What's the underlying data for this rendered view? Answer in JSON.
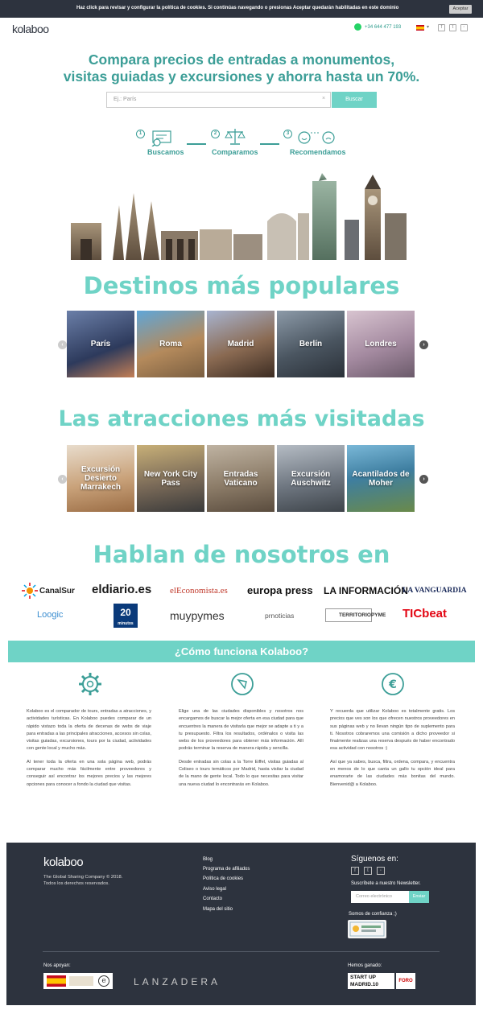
{
  "cookie": {
    "text": "Haz click para revisar y configurar la política de cookies. Si continúas navegando o presionas Aceptar quedarán habilitadas en este dominio",
    "accept": "Aceptar"
  },
  "header": {
    "logo": "kolaboo",
    "phone": "+34 644 477 193"
  },
  "hero": {
    "title_line1": "Compara precios de entradas a monumentos,",
    "title_line2": "visitas guiadas y excursiones y ahorra hasta un 70%.",
    "search_placeholder": "Ej.: París",
    "search_button": "Buscar"
  },
  "steps": [
    {
      "num": "1",
      "label": "Buscamos"
    },
    {
      "num": "2",
      "label": "Comparamos"
    },
    {
      "num": "3",
      "label": "Recomendamos"
    }
  ],
  "destinations": {
    "title": "Destinos más populares",
    "items": [
      "París",
      "Roma",
      "Madrid",
      "Berlín",
      "Londres"
    ]
  },
  "attractions": {
    "title": "Las atracciones más visitadas",
    "items": [
      "Excursión Desierto Marrakech",
      "New York City Pass",
      "Entradas Vaticano",
      "Excursión Auschwitz",
      "Acantilados de Moher"
    ]
  },
  "press": {
    "title": "Hablan de nosotros en",
    "logos": [
      "CanalSur",
      "eldiario.es",
      "elEconomista.es",
      "europa press",
      "LA INFORMACIÓN",
      "LA VANGUARDIA",
      "Loogic",
      "20 minutos",
      "muypymes",
      "prnoticias",
      "TERRITORIOPYME",
      "TICbeat"
    ]
  },
  "how": {
    "title": "¿Cómo funciona Kolaboo?",
    "col1": [
      "Kolaboo es el comparador de tours, entradas a atracciones, y actividades turísticas. En Kolaboo puedes comparar de un rápido vistazo toda la oferta de decenas de webs de viaje para entradas a las principales atracciones, accesos sin colas, visitas guiadas, excursiones, tours por la ciudad, actividades con gente local y mucho más.",
      "Al tener toda la oferta en una sola página web, podrás comparar mucho más fácilmente entre proveedores y conseguir así encontrar los mejores precios y las mejores opciones para conocer a fondo la ciudad que visitas."
    ],
    "col2": [
      "Elige una de las ciudades disponibles y nosotros nos encargamos de buscar la mejor oferta en esa ciudad para que encuentres la manera de visitarla que mejor se adapte a ti y a tu presupuesto. Filtra los resultados, ordénalos o visita las webs de los proveedores para obtener más información. Allí podrás terminar la reserva de manera rápida y sencilla.",
      "Desde entradas sin colas a la Torre Eiffel, visitas guiadas al Coliseo o tours temáticos por Madrid, hasta visitar la ciudad de la mano de gente local. Todo lo que necesitas para visitar una nueva ciudad lo encontrarás en Kolaboo."
    ],
    "col3": [
      "Y recuerda que utilizar Kolaboo es totalmente gratis. Los precios que ves son los que ofrecen nuestros proveedores en sus páginas web y no llevan ningún tipo de suplemento para ti. Nosotros cobraremos una comisión a dicho proveedor si finalmente realizas una reserva después de haber encontrado esa actividad con nosotros :)",
      "Así que ya sabes, busca, filtra, ordena, compara, y encuentra en menos de lo que canta un gallo tu opción ideal para enamorarte de las ciudades más bonitas del mundo. Bienvenid@ a Kolaboo."
    ]
  },
  "footer": {
    "logo": "kolaboo",
    "copy1": "The Global Sharing Company © 2018.",
    "copy2": "Todos los derechos reservados.",
    "links": [
      "Blog",
      "Programa de afiliados",
      "Política de cookies",
      "Aviso legal",
      "Contacto",
      "Mapa del sitio"
    ],
    "follow": "Síguenos en:",
    "newsletter": "Suscríbete a nuestro Newsletter.",
    "email_placeholder": "Correo electrónico",
    "send": "Enviar",
    "trust": "Somos de confianza ;)",
    "support": "Nos apoyan:",
    "won": "Hemos ganado:",
    "lanzadera": "LANZADERA",
    "startup": "START UP MADRID.10",
    "foro": "FORO"
  },
  "colors": {
    "accent": "#6fd3c6",
    "accent_dark": "#3c9e97",
    "footer_bg": "#2d333e"
  }
}
